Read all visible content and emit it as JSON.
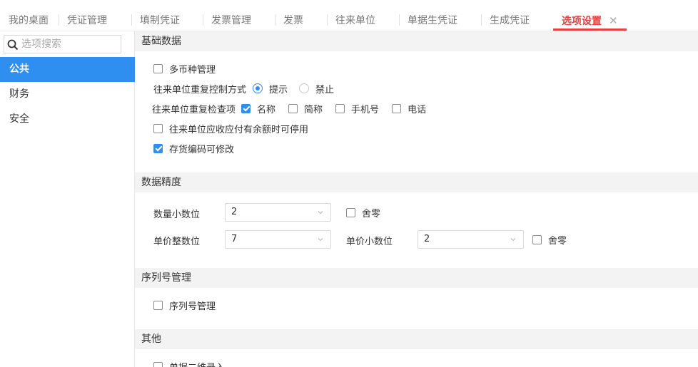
{
  "tabs": [
    {
      "label": "我的桌面",
      "active": false
    },
    {
      "label": "凭证管理",
      "active": false
    },
    {
      "label": "填制凭证",
      "active": false
    },
    {
      "label": "发票管理",
      "active": false
    },
    {
      "label": "发票",
      "active": false
    },
    {
      "label": "往来单位",
      "active": false
    },
    {
      "label": "单据生凭证",
      "active": false
    },
    {
      "label": "生成凭证",
      "active": false
    },
    {
      "label": "选项设置",
      "active": true
    }
  ],
  "sidebar": {
    "search_placeholder": "选项搜索",
    "items": [
      {
        "label": "公共",
        "active": true
      },
      {
        "label": "财务",
        "active": false
      },
      {
        "label": "安全",
        "active": false
      }
    ]
  },
  "sections": {
    "basic": {
      "title": "基础数据",
      "multi_currency": {
        "label": "多币种管理",
        "checked": false
      },
      "dup_control": {
        "label": "往来单位重复控制方式",
        "options": [
          {
            "label": "提示",
            "selected": true
          },
          {
            "label": "禁止",
            "selected": false
          }
        ]
      },
      "dup_check": {
        "label": "往来单位重复检查项",
        "options": [
          {
            "label": "名称",
            "checked": true
          },
          {
            "label": "简称",
            "checked": false
          },
          {
            "label": "手机号",
            "checked": false
          },
          {
            "label": "电话",
            "checked": false
          }
        ]
      },
      "disable_with_balance": {
        "label": "往来单位应收应付有余额时可停用",
        "checked": false
      },
      "inventory_code_editable": {
        "label": "存货编码可修改",
        "checked": true
      }
    },
    "precision": {
      "title": "数据精度",
      "qty_decimals": {
        "label": "数量小数位",
        "value": "2"
      },
      "qty_round": {
        "label": "舍零",
        "checked": false
      },
      "price_int": {
        "label": "单价整数位",
        "value": "7"
      },
      "price_decimals": {
        "label": "单价小数位",
        "value": "2"
      },
      "price_round": {
        "label": "舍零",
        "checked": false
      }
    },
    "serial": {
      "title": "序列号管理",
      "serial_mgmt": {
        "label": "序列号管理",
        "checked": false
      }
    },
    "other": {
      "title": "其他",
      "doc_2d": {
        "label": "单据二维录入",
        "checked": false
      }
    }
  },
  "colors": {
    "accent": "#2f8ff0",
    "active_tab": "#e8413f"
  }
}
